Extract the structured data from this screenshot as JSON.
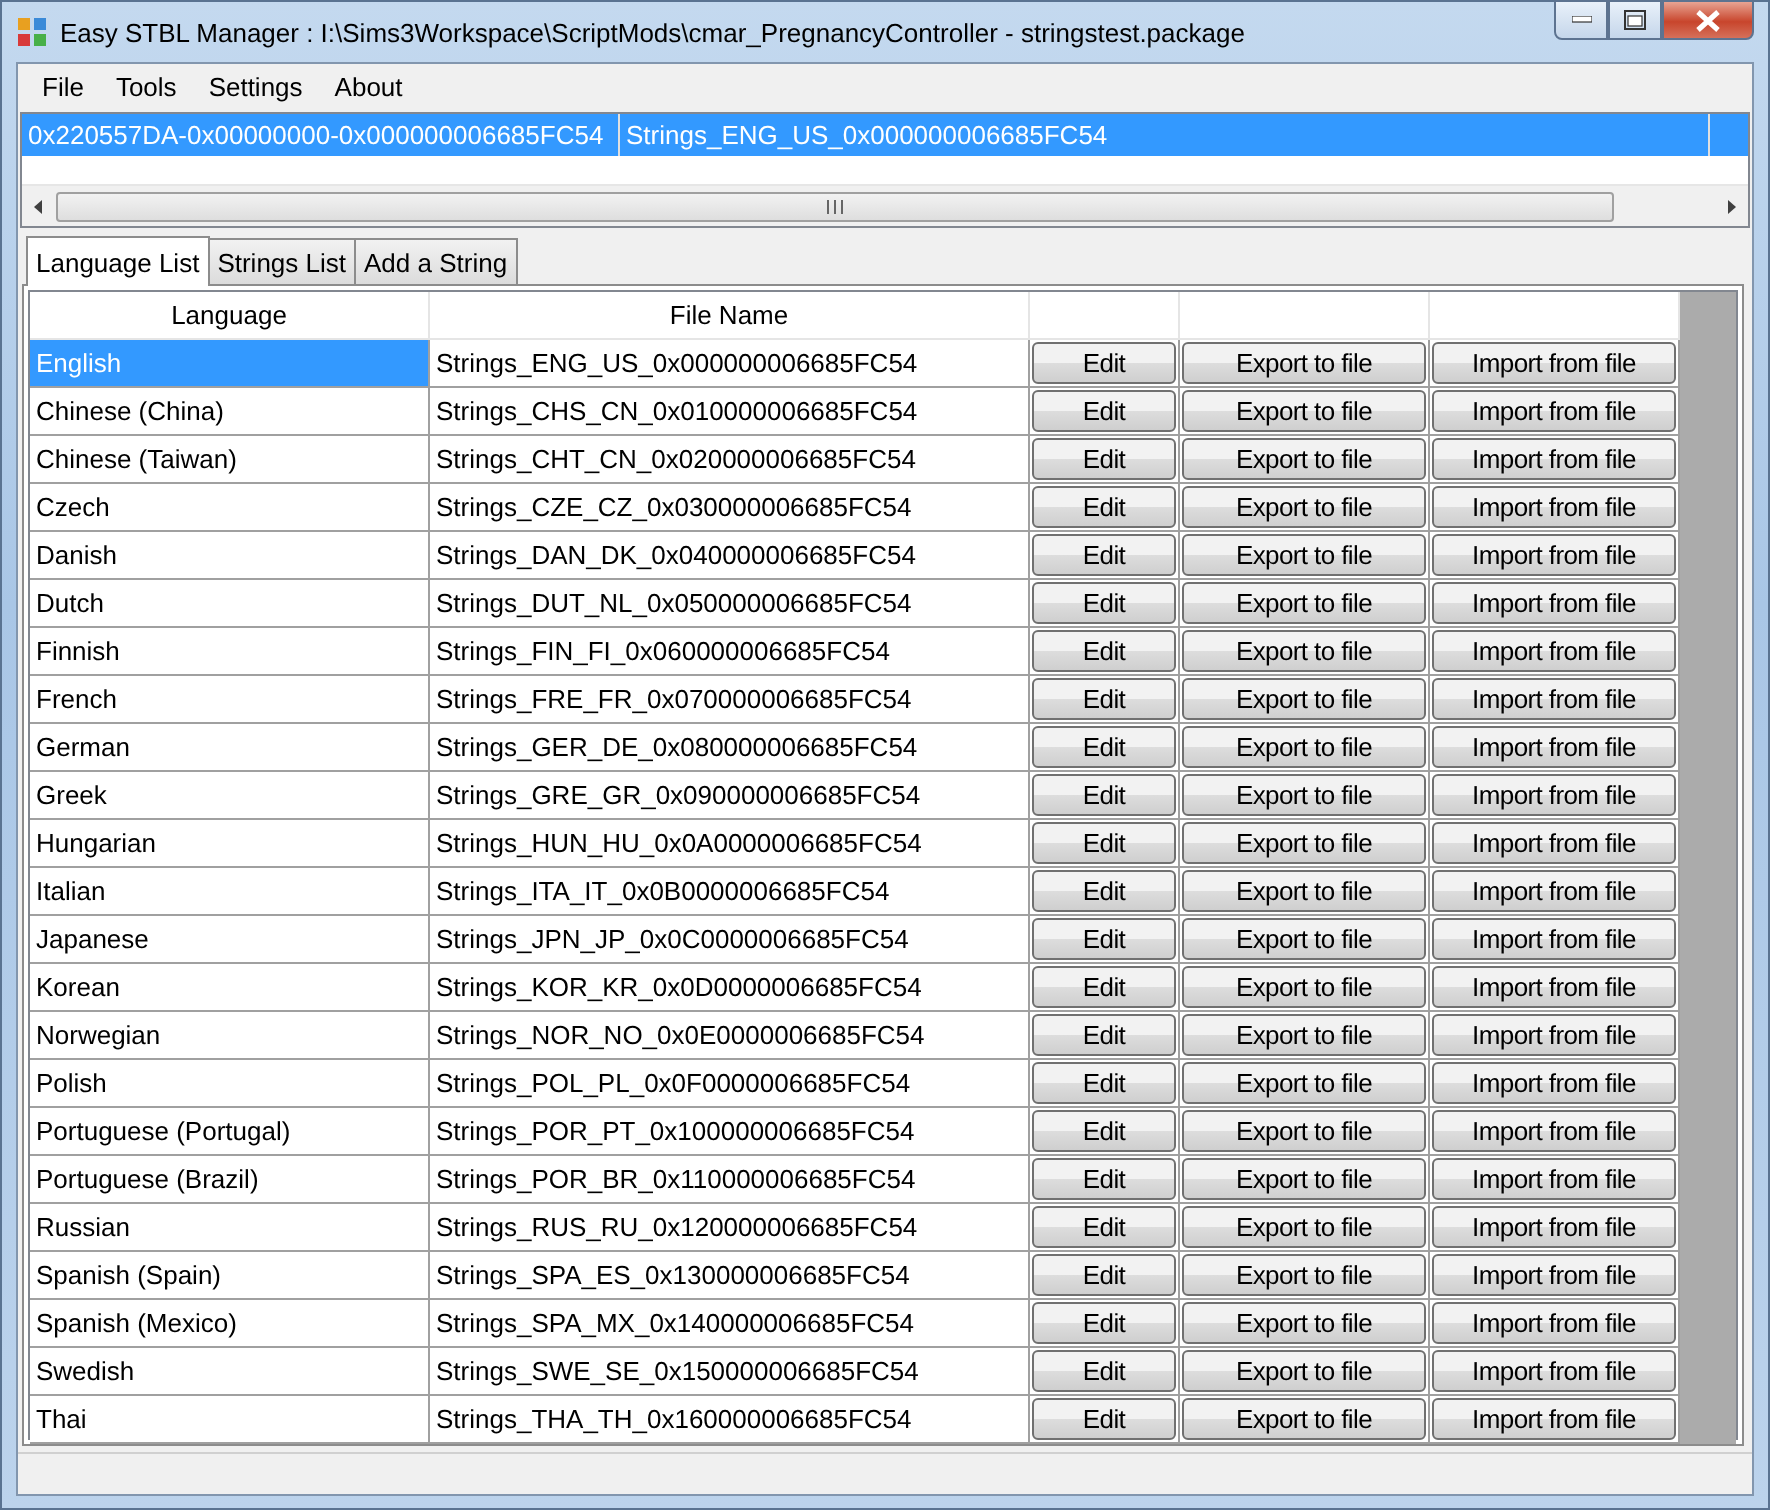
{
  "window": {
    "title": "Easy STBL Manager : I:\\Sims3Workspace\\ScriptMods\\cmar_PregnancyController - stringstest.package"
  },
  "menu": [
    "File",
    "Tools",
    "Settings",
    "About"
  ],
  "resource_list": {
    "rows": [
      {
        "instance": "0x220557DA-0x00000000-0x000000006685FC54",
        "name": "Strings_ENG_US_0x000000006685FC54",
        "selected": true
      }
    ]
  },
  "tabs": [
    {
      "label": "Language List",
      "selected": true
    },
    {
      "label": "Strings List",
      "selected": false
    },
    {
      "label": "Add a String",
      "selected": false
    }
  ],
  "table": {
    "columns": [
      "Language",
      "File Name"
    ],
    "rows": [
      {
        "language": "English",
        "file_name": "Strings_ENG_US_0x000000006685FC54",
        "selected": true,
        "buttons": [
          "Edit",
          "Export to file",
          "Import from file"
        ]
      },
      {
        "language": "Chinese (China)",
        "file_name": "Strings_CHS_CN_0x010000006685FC54",
        "selected": false,
        "buttons": [
          "Edit",
          "Export to file",
          "Import from file"
        ]
      },
      {
        "language": "Chinese (Taiwan)",
        "file_name": "Strings_CHT_CN_0x020000006685FC54",
        "selected": false,
        "buttons": [
          "Edit",
          "Export to file",
          "Import from file"
        ]
      },
      {
        "language": "Czech",
        "file_name": "Strings_CZE_CZ_0x030000006685FC54",
        "selected": false,
        "buttons": [
          "Edit",
          "Export to file",
          "Import from file"
        ]
      },
      {
        "language": "Danish",
        "file_name": "Strings_DAN_DK_0x040000006685FC54",
        "selected": false,
        "buttons": [
          "Edit",
          "Export to file",
          "Import from file"
        ]
      },
      {
        "language": "Dutch",
        "file_name": "Strings_DUT_NL_0x050000006685FC54",
        "selected": false,
        "buttons": [
          "Edit",
          "Export to file",
          "Import from file"
        ]
      },
      {
        "language": "Finnish",
        "file_name": "Strings_FIN_FI_0x060000006685FC54",
        "selected": false,
        "buttons": [
          "Edit",
          "Export to file",
          "Import from file"
        ]
      },
      {
        "language": "French",
        "file_name": "Strings_FRE_FR_0x070000006685FC54",
        "selected": false,
        "buttons": [
          "Edit",
          "Export to file",
          "Import from file"
        ]
      },
      {
        "language": "German",
        "file_name": "Strings_GER_DE_0x080000006685FC54",
        "selected": false,
        "buttons": [
          "Edit",
          "Export to file",
          "Import from file"
        ]
      },
      {
        "language": "Greek",
        "file_name": "Strings_GRE_GR_0x090000006685FC54",
        "selected": false,
        "buttons": [
          "Edit",
          "Export to file",
          "Import from file"
        ]
      },
      {
        "language": "Hungarian",
        "file_name": "Strings_HUN_HU_0x0A0000006685FC54",
        "selected": false,
        "buttons": [
          "Edit",
          "Export to file",
          "Import from file"
        ]
      },
      {
        "language": "Italian",
        "file_name": "Strings_ITA_IT_0x0B0000006685FC54",
        "selected": false,
        "buttons": [
          "Edit",
          "Export to file",
          "Import from file"
        ]
      },
      {
        "language": "Japanese",
        "file_name": "Strings_JPN_JP_0x0C0000006685FC54",
        "selected": false,
        "buttons": [
          "Edit",
          "Export to file",
          "Import from file"
        ]
      },
      {
        "language": "Korean",
        "file_name": "Strings_KOR_KR_0x0D0000006685FC54",
        "selected": false,
        "buttons": [
          "Edit",
          "Export to file",
          "Import from file"
        ]
      },
      {
        "language": "Norwegian",
        "file_name": "Strings_NOR_NO_0x0E0000006685FC54",
        "selected": false,
        "buttons": [
          "Edit",
          "Export to file",
          "Import from file"
        ]
      },
      {
        "language": "Polish",
        "file_name": "Strings_POL_PL_0x0F0000006685FC54",
        "selected": false,
        "buttons": [
          "Edit",
          "Export to file",
          "Import from file"
        ]
      },
      {
        "language": "Portuguese (Portugal)",
        "file_name": "Strings_POR_PT_0x100000006685FC54",
        "selected": false,
        "buttons": [
          "Edit",
          "Export to file",
          "Import from file"
        ]
      },
      {
        "language": "Portuguese (Brazil)",
        "file_name": "Strings_POR_BR_0x110000006685FC54",
        "selected": false,
        "buttons": [
          "Edit",
          "Export to file",
          "Import from file"
        ]
      },
      {
        "language": "Russian",
        "file_name": "Strings_RUS_RU_0x120000006685FC54",
        "selected": false,
        "buttons": [
          "Edit",
          "Export to file",
          "Import from file"
        ]
      },
      {
        "language": "Spanish (Spain)",
        "file_name": "Strings_SPA_ES_0x130000006685FC54",
        "selected": false,
        "buttons": [
          "Edit",
          "Export to file",
          "Import from file"
        ]
      },
      {
        "language": "Spanish (Mexico)",
        "file_name": "Strings_SPA_MX_0x140000006685FC54",
        "selected": false,
        "buttons": [
          "Edit",
          "Export to file",
          "Import from file"
        ]
      },
      {
        "language": "Swedish",
        "file_name": "Strings_SWE_SE_0x150000006685FC54",
        "selected": false,
        "buttons": [
          "Edit",
          "Export to file",
          "Import from file"
        ]
      },
      {
        "language": "Thai",
        "file_name": "Strings_THA_TH_0x160000006685FC54",
        "selected": false,
        "buttons": [
          "Edit",
          "Export to file",
          "Import from file"
        ]
      }
    ]
  }
}
